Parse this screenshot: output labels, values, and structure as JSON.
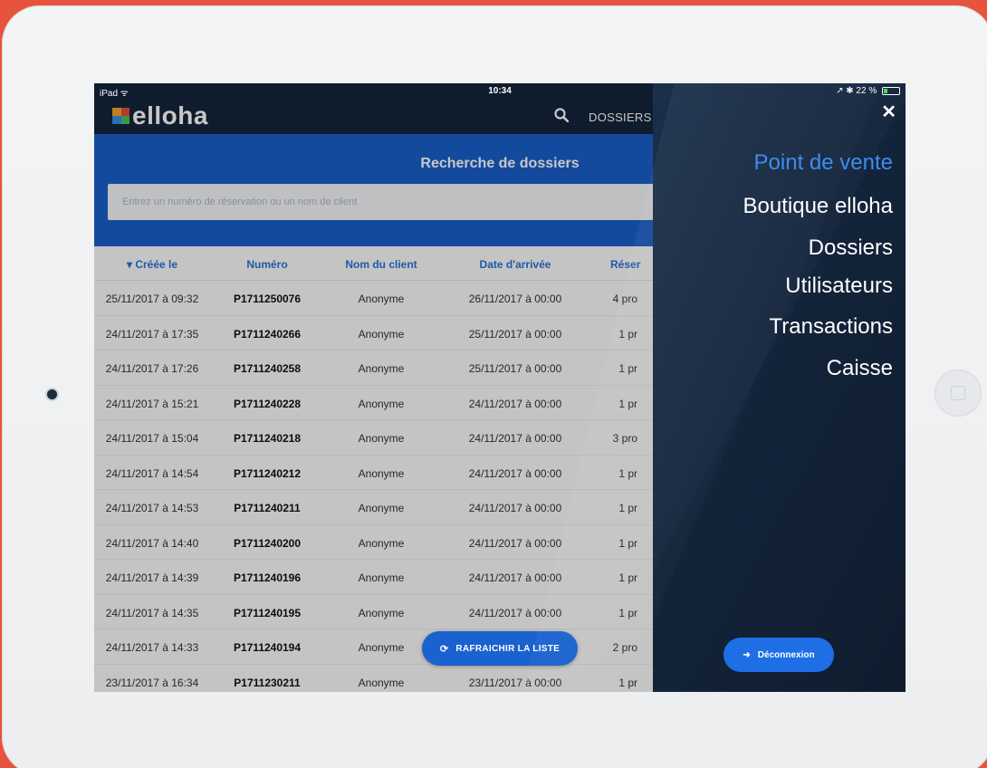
{
  "status_bar": {
    "carrier": "iPad ᯤ",
    "time": "10:34",
    "battery": "↗ ✱ 22 %"
  },
  "header": {
    "brand": "elloha",
    "nav_label": "DOSSIERS"
  },
  "search": {
    "title": "Recherche de dossiers",
    "placeholder": "Entrez un numéro de réservation ou un nom de client"
  },
  "table": {
    "columns": [
      "▾ Créée le",
      "Numéro",
      "Nom du client",
      "Date d'arrivée",
      "Réser"
    ],
    "rows": [
      [
        "25/11/2017 à 09:32",
        "P1711250076",
        "Anonyme",
        "26/11/2017 à 00:00",
        "4 pro"
      ],
      [
        "24/11/2017 à 17:35",
        "P1711240266",
        "Anonyme",
        "25/11/2017 à 00:00",
        "1 pr"
      ],
      [
        "24/11/2017 à 17:26",
        "P1711240258",
        "Anonyme",
        "25/11/2017 à 00:00",
        "1 pr"
      ],
      [
        "24/11/2017 à 15:21",
        "P1711240228",
        "Anonyme",
        "24/11/2017 à 00:00",
        "1 pr"
      ],
      [
        "24/11/2017 à 15:04",
        "P1711240218",
        "Anonyme",
        "24/11/2017 à 00:00",
        "3 pro"
      ],
      [
        "24/11/2017 à 14:54",
        "P1711240212",
        "Anonyme",
        "24/11/2017 à 00:00",
        "1 pr"
      ],
      [
        "24/11/2017 à 14:53",
        "P1711240211",
        "Anonyme",
        "24/11/2017 à 00:00",
        "1 pr"
      ],
      [
        "24/11/2017 à 14:40",
        "P1711240200",
        "Anonyme",
        "24/11/2017 à 00:00",
        "1 pr"
      ],
      [
        "24/11/2017 à 14:39",
        "P1711240196",
        "Anonyme",
        "24/11/2017 à 00:00",
        "1 pr"
      ],
      [
        "24/11/2017 à 14:35",
        "P1711240195",
        "Anonyme",
        "24/11/2017 à 00:00",
        "1 pr"
      ],
      [
        "24/11/2017 à 14:33",
        "P1711240194",
        "Anonyme",
        "",
        "2 pro"
      ],
      [
        "23/11/2017 à 16:34",
        "P1711230211",
        "Anonyme",
        "23/11/2017 à 00:00",
        "1 pr"
      ]
    ]
  },
  "refresh_button": {
    "label": "RAFRAICHIR LA LISTE"
  },
  "menu": {
    "items": [
      "Point de vente",
      "Boutique elloha",
      "Dossiers",
      "Utilisateurs",
      "Transactions",
      "Caisse"
    ],
    "active_index": 0,
    "logout_label": "Déconnexion"
  },
  "colors": {
    "background": "#e8533d",
    "topbar": "#14243a",
    "search_header": "#1a5fc9",
    "menu": "#13243a",
    "accent": "#3e8df0"
  }
}
